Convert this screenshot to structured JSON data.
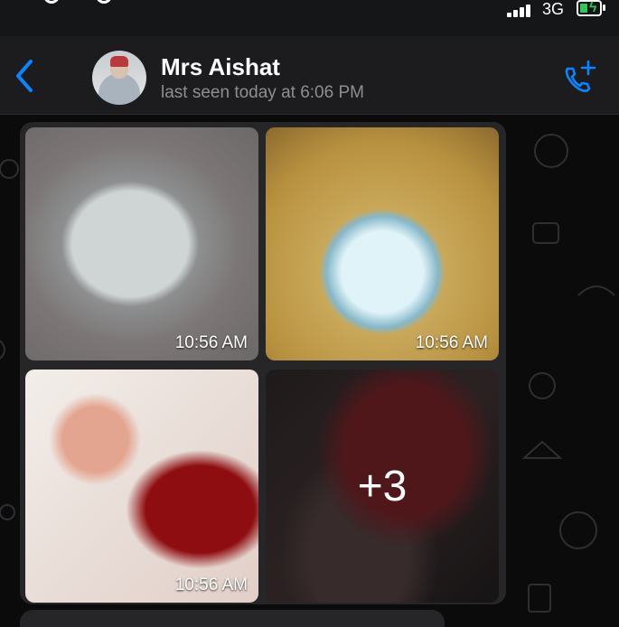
{
  "status_bar": {
    "network": "3G",
    "colors": {
      "battery": "#34c759"
    },
    "icons": [
      "hotspot-icon",
      "signal-icon",
      "battery-charging-icon"
    ]
  },
  "header": {
    "contact_name": "Mrs Aishat",
    "last_seen": "last seen today at 6:06 PM",
    "icons": {
      "back": "chevron-left-icon",
      "call": "phone-add-icon"
    },
    "accent_color": "#0a84ff"
  },
  "media_group": {
    "tiles": [
      {
        "time": "10:56 AM"
      },
      {
        "time": "10:56 AM"
      },
      {
        "time": "10:56 AM"
      },
      {
        "overlay": "+3"
      }
    ]
  }
}
